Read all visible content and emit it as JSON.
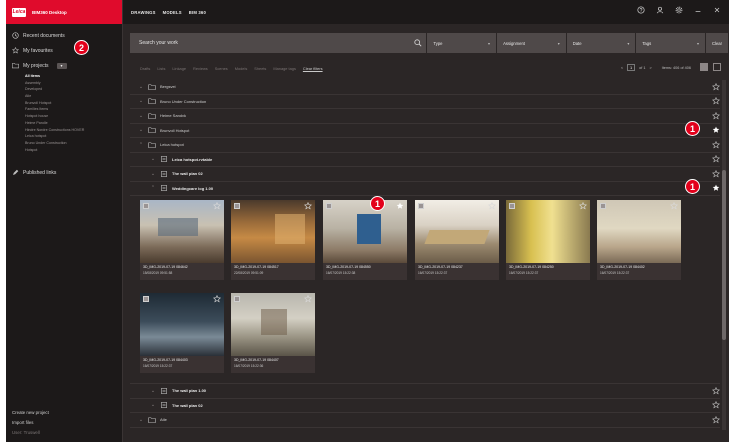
{
  "brand": {
    "logo": "Leica",
    "name": "BIM360 Desktop"
  },
  "nav": {
    "recent": "Recent documents",
    "favourites": "My favourites",
    "projects": "My projects",
    "projects_badge": "▾",
    "published": "Published links"
  },
  "projects": [
    "All items",
    "Assembly",
    "Developed",
    "Atle",
    "Brunvoll Hotspot",
    "Families Items",
    "Hotspot house",
    "Heime Pandle",
    "Hindre Nordre Constructions HOVER",
    "Leica hotspot",
    "Bruno Under Construction",
    "Hotspot"
  ],
  "footer": {
    "create": "Create new project",
    "import": "Import files",
    "user": "User: Truswell"
  },
  "tabs": [
    "DRAWINGS",
    "MODELS",
    "BIM 360"
  ],
  "search": {
    "placeholder": "Search your work"
  },
  "filters": [
    {
      "label": "Type"
    },
    {
      "label": "Assignment"
    },
    {
      "label": "Date"
    },
    {
      "label": "Tags"
    },
    {
      "label": "Clear"
    }
  ],
  "chips": [
    "Drafts",
    "Lists",
    "Linkage",
    "Reviews",
    "Scenes",
    "Models",
    "Sheets",
    "Manage tags"
  ],
  "clear_filters": "Clear filters",
  "pager": {
    "prefix": "<",
    "page": "1",
    "of": "of 1",
    "next": ">",
    "summary": "Items: 406 of 406"
  },
  "folders_top": [
    {
      "label": "Bergsvei"
    },
    {
      "label": "Bruno Under Construction"
    },
    {
      "label": "Heime Sandvk"
    },
    {
      "label": "Brunvoll Hotspot"
    },
    {
      "label": "Leica hotspot"
    }
  ],
  "subrows_top": [
    {
      "label": "Leica hotspot.rvtable"
    },
    {
      "label": "The wall plan 02"
    },
    {
      "label": "Weddingcare log 1.00"
    }
  ],
  "thumbs": [
    {
      "name": "3D_IMG-2019-07-19 084642",
      "date": "15/08/2019 09:51:58"
    },
    {
      "name": "3D_IMG-2019-07-19 084517",
      "date": "22/08/2019 09:51:09"
    },
    {
      "name": "3D_IMG-2019-07-19 084550",
      "date": "16/07/2019 15:22:38"
    },
    {
      "name": "3D_IMG-2019-07-19 084237",
      "date": "16/07/2019 15:22:37"
    },
    {
      "name": "3D_IMG-2019-07-19 084250",
      "date": "16/07/2019 15:22:37"
    },
    {
      "name": "3D_IMG-2019-07-19 084402",
      "date": "16/07/2019 15:22:37"
    },
    {
      "name": "3D_IMG-2019-07-19 084403",
      "date": "16/07/2019 15:22:37"
    },
    {
      "name": "3D_IMG-2019-07-19 084407",
      "date": "16/07/2019 15:22:36"
    }
  ],
  "subrows_bottom": [
    {
      "label": "The wall plan 1.00"
    },
    {
      "label": "The wall plan 02"
    }
  ],
  "folders_bottom": [
    {
      "label": "Atle"
    }
  ],
  "callouts": {
    "a": "1",
    "b": "1",
    "c": "1",
    "d": "2"
  },
  "colors": {
    "accent": "#e00b2c",
    "callout": "#e3001b",
    "panel": "#2b2626",
    "sidebar": "#1c1919"
  }
}
